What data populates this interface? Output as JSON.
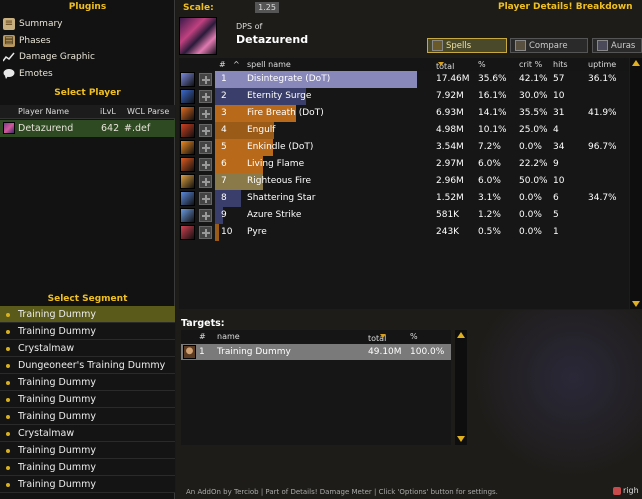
{
  "plugins": {
    "title": "Plugins",
    "items": [
      {
        "label": "Summary",
        "icon": "scroll-icon"
      },
      {
        "label": "Phases",
        "icon": "map-icon"
      },
      {
        "label": "Damage Graphic",
        "icon": "chart-line-icon"
      },
      {
        "label": "Emotes",
        "icon": "speech-bubble-icon"
      }
    ]
  },
  "select_player": {
    "title": "Select Player",
    "headers": {
      "name": "Player Name",
      "ilvl": "iLvL",
      "wcl": "WCL Parse"
    },
    "row": {
      "name": "Detazurend",
      "ilvl": "642",
      "wcl": "#.def"
    }
  },
  "select_segment": {
    "title": "Select Segment",
    "items": [
      "Training Dummy",
      "Training Dummy",
      "Crystalmaw",
      "Dungeoneer's Training Dummy",
      "Training Dummy",
      "Training Dummy",
      "Training Dummy",
      "Crystalmaw",
      "Training Dummy",
      "Training Dummy",
      "Training Dummy"
    ]
  },
  "main": {
    "scale_label": "Scale:",
    "scale_value": "1.25",
    "breakdown_title": "Player Details! Breakdown",
    "dps_of": "DPS of",
    "player_name": "Detazurend",
    "tabs": [
      {
        "label": "Spells",
        "active": true
      },
      {
        "label": "Compare",
        "active": false
      },
      {
        "label": "Auras",
        "active": false
      }
    ]
  },
  "spells": {
    "headers": {
      "num": "#",
      "caret": "^",
      "name": "spell name",
      "total": "total",
      "pct": "%",
      "crit": "crit %",
      "hits": "hits",
      "uptime": "uptime"
    },
    "rows": [
      {
        "rank": "1",
        "name": "Disintegrate (DoT)",
        "total": "17.46M",
        "pct": "35.6%",
        "crit": "42.1%",
        "hits": "57",
        "uptime": "36.1%",
        "bar": 1.0,
        "color": "#8888bb",
        "icon": "#7a8ae0"
      },
      {
        "rank": "2",
        "name": "Eternity Surge",
        "total": "7.92M",
        "pct": "16.1%",
        "crit": "30.0%",
        "hits": "10",
        "uptime": "",
        "bar": 0.45,
        "color": "#3a3e6a",
        "icon": "#3a6ad0"
      },
      {
        "rank": "3",
        "name": "Fire Breath (DoT)",
        "total": "6.93M",
        "pct": "14.1%",
        "crit": "35.5%",
        "hits": "31",
        "uptime": "41.9%",
        "bar": 0.4,
        "color": "#b86a1a",
        "icon": "#e06a20"
      },
      {
        "rank": "4",
        "name": "Engulf",
        "total": "4.98M",
        "pct": "10.1%",
        "crit": "25.0%",
        "hits": "4",
        "uptime": "",
        "bar": 0.29,
        "color": "#9a5a18",
        "icon": "#d04020"
      },
      {
        "rank": "5",
        "name": "Enkindle (DoT)",
        "total": "3.54M",
        "pct": "7.2%",
        "crit": "0.0%",
        "hits": "34",
        "uptime": "96.7%",
        "bar": 0.0,
        "color": "#b86a1a",
        "icon": "#f08a20"
      },
      {
        "rank": "6",
        "name": "Living Flame",
        "total": "2.97M",
        "pct": "6.0%",
        "crit": "22.2%",
        "hits": "9",
        "uptime": "",
        "bar": 0.0,
        "color": "#b86a1a",
        "icon": "#e05a20"
      },
      {
        "rank": "7",
        "name": "Righteous Fire",
        "total": "2.96M",
        "pct": "6.0%",
        "crit": "50.0%",
        "hits": "10",
        "uptime": "",
        "bar": 0.0,
        "color": "#8a7a4a",
        "icon": "#e0a040"
      },
      {
        "rank": "8",
        "name": "Shattering Star",
        "total": "1.52M",
        "pct": "3.1%",
        "crit": "0.0%",
        "hits": "6",
        "uptime": "34.7%",
        "bar": 0.0,
        "color": "#3a3e6a",
        "icon": "#5a8ae0"
      },
      {
        "rank": "9",
        "name": "Azure Strike",
        "total": "581K",
        "pct": "1.2%",
        "crit": "0.0%",
        "hits": "5",
        "uptime": "",
        "bar": 0.0,
        "color": "#3a3e6a",
        "icon": "#6a9ae0"
      },
      {
        "rank": "10",
        "name": "Pyre",
        "total": "243K",
        "pct": "0.5%",
        "crit": "0.0%",
        "hits": "1",
        "uptime": "",
        "bar": 0.0,
        "color": "#9a5a18",
        "icon": "#d04050"
      }
    ]
  },
  "targets": {
    "title": "Targets:",
    "headers": {
      "num": "#",
      "name": "name",
      "total": "total",
      "pct": "%"
    },
    "rows": [
      {
        "rank": "1",
        "name": "Training Dummy",
        "total": "49.10M",
        "pct": "100.0%"
      }
    ]
  },
  "footer": "An AddOn by Terciob | Part of Details! Damage Meter | Click 'Options' button for settings.",
  "corner_text": "righ"
}
